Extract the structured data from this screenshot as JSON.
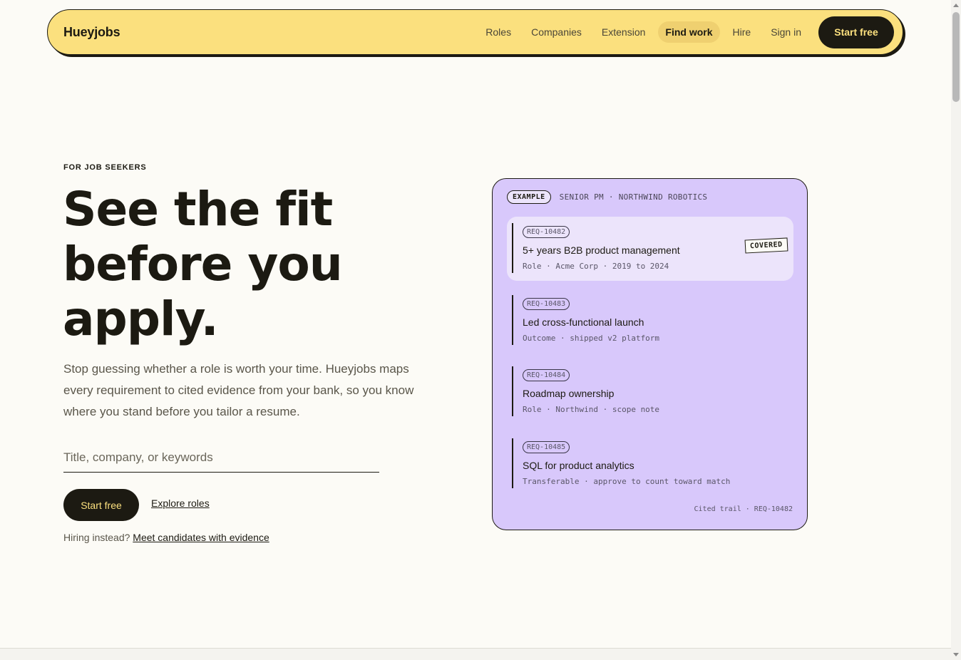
{
  "nav": {
    "brand": "Hueyjobs",
    "links": [
      {
        "label": "Roles"
      },
      {
        "label": "Companies"
      },
      {
        "label": "Extension"
      },
      {
        "label": "Find work",
        "active": true
      },
      {
        "label": "Hire"
      },
      {
        "label": "Sign in"
      }
    ],
    "cta": "Start free"
  },
  "hero": {
    "eyebrow": "FOR JOB SEEKERS",
    "headline_lines": [
      "See the fit",
      "before you",
      "apply."
    ],
    "subtext": "Stop guessing whether a role is worth your time. Hueyjobs maps every requirement to cited evidence from your bank, so you know where you stand before you tailor a resume.",
    "search_placeholder": "Title, company, or keywords",
    "search_value": "",
    "primary_button": "Start free",
    "secondary_link": "Explore roles",
    "hiring_prompt": "Hiring instead?",
    "hiring_link": "Meet candidates with evidence"
  },
  "card": {
    "tag": "EXAMPLE",
    "context": "SENIOR PM · NORTHWIND ROBOTICS",
    "requirements": [
      {
        "code": "REQ-10482",
        "title": "5+ years B2B product management",
        "meta": "Role · Acme Corp · 2019 to 2024",
        "badge": "COVERED",
        "highlighted": true
      },
      {
        "code": "REQ-10483",
        "title": "Led cross-functional launch",
        "meta": "Outcome · shipped v2 platform",
        "badge": "",
        "highlighted": false
      },
      {
        "code": "REQ-10484",
        "title": "Roadmap ownership",
        "meta": "Role · Northwind · scope note",
        "badge": "",
        "highlighted": false
      },
      {
        "code": "REQ-10485",
        "title": "SQL for product analytics",
        "meta": "Transferable · approve to count toward match",
        "badge": "",
        "highlighted": false
      }
    ],
    "footer": "Cited trail · REQ-10482"
  },
  "colors": {
    "nav_bg": "#fbe07e",
    "ink": "#1c1a12",
    "card_bg": "#d8c8fb",
    "page_bg": "#fcfbf6"
  }
}
